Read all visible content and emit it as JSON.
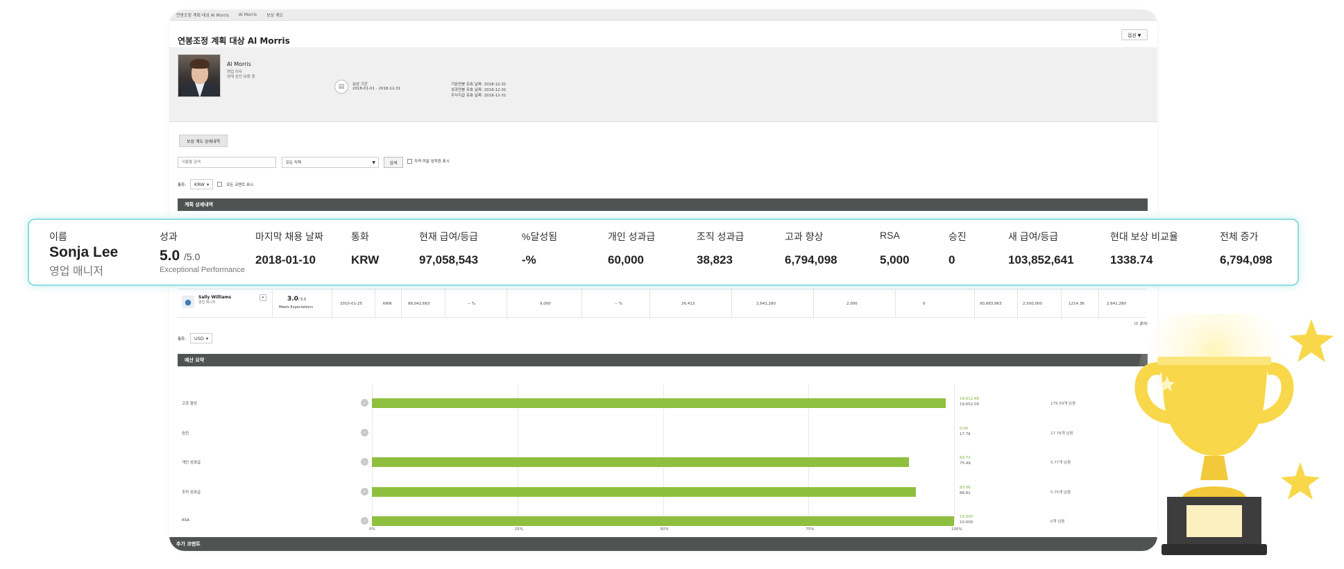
{
  "breadcrumb": [
    "연봉조정 계획 대상 Al Morris",
    "Al Morris",
    "보상 계도"
  ],
  "page_title": "연봉조정 계획 대상 Al Morris",
  "options_label": "옵션 ▼",
  "employee": {
    "name": "Al Morris",
    "role": "영업 이사",
    "status": "상태 승인 보류 중"
  },
  "period": {
    "label": "보상 기간",
    "value": "2018-01-01 - 2018-12-31"
  },
  "effective_dates": [
    {
      "label": "기본연봉 유효 날짜:",
      "value": "2018-12-31"
    },
    {
      "label": "성과연봉 유효 날짜:",
      "value": "2018-12-31"
    },
    {
      "label": "주식지급 유효 날짜:",
      "value": "2018-12-31"
    }
  ],
  "tab_label": "보상 계도 상세내역",
  "filters": {
    "search_placeholder": "이름별 검색",
    "job_select": "모든 직책",
    "search_button": "검색",
    "excluded_checkbox": "자격 미달 임직원 표시"
  },
  "currency": {
    "label": "통화:",
    "value": "KRW",
    "comments_checkbox": "모든 코멘트 표시"
  },
  "plan_details_title": "계획 상세내역",
  "highlight_card": {
    "headers": [
      "이름",
      "성과",
      "마지막 채용 날짜",
      "통화",
      "현재 급여/등급",
      "%달성됨",
      "개인 성과급",
      "조직 성과급",
      "고과 향상",
      "RSA",
      "승진",
      "새 급여/등급",
      "현대 보상 비교율",
      "전체 증가"
    ],
    "name": "Sonja Lee",
    "role": "영업 매니저",
    "score": "5.0",
    "score_max": "/5.0",
    "score_label": "Exceptional Performance",
    "values": [
      "2018-01-10",
      "KRW",
      "97,058,543",
      "-%",
      "60,000",
      "38,823",
      "6,794,098",
      "5,000",
      "0",
      "103,852,641",
      "1338.74",
      "6,794,098"
    ]
  },
  "sally_row": {
    "name": "Sally Williams",
    "role": "영업 매니저",
    "score": "3.0",
    "score_max": "/ 5.0",
    "score_label": "Meets Expectations",
    "cells": [
      "2010-01-25",
      "KRW",
      "88,042,663",
      "-- %",
      "9,000",
      "-- %",
      "26,413",
      "2,641,280",
      "2,000",
      "0",
      "90,683,963",
      "2,500,000",
      "1214.36",
      "2,641,280"
    ]
  },
  "results_count": "(3 결과)",
  "currency2": {
    "label": "통화:",
    "value": "USD"
  },
  "budget_title": "예산 요약",
  "chart_data": {
    "type": "bar",
    "orientation": "horizontal",
    "title": "예산 요약",
    "categories": [
      "고과 향상",
      "승진",
      "개인 성과급",
      "조직 성과급",
      "RSA"
    ],
    "values": [
      98.6,
      0,
      92.3,
      93.4,
      100
    ],
    "x_ticks": [
      "0%",
      "25%",
      "50%",
      "75%",
      "100%"
    ],
    "xlim": [
      0,
      100
    ],
    "used": [
      "19,612.48",
      "0.00",
      "69.72",
      "83.06",
      "10,000"
    ],
    "total": [
      "19,652.09",
      "17.76",
      "75.49",
      "88.81",
      "10,000"
    ],
    "remaining": [
      "179.59개 남음",
      "17.76개 남음",
      "5.77개 남음",
      "5.75개 남음",
      "0개 남음"
    ],
    "bar_color": "#8fbf3f"
  },
  "comments_title": "추가 코멘트",
  "colors": {
    "accent_teal": "#8fdce0",
    "dark_bar": "#4f5452",
    "trophy_gold": "#f8d84a"
  }
}
